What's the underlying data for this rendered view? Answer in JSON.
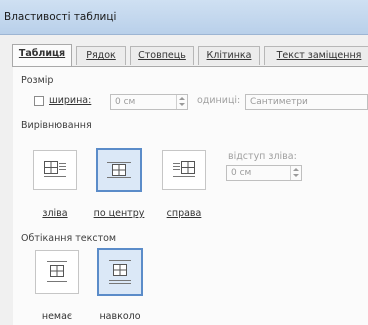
{
  "window": {
    "title": "Властивості таблиці"
  },
  "tabs": [
    {
      "label": "Таблиця",
      "active": true
    },
    {
      "label": "Рядок",
      "active": false
    },
    {
      "label": "Стовпець",
      "active": false
    },
    {
      "label": "Клітинка",
      "active": false
    },
    {
      "label": "Текст заміщення",
      "active": false
    }
  ],
  "size": {
    "section_label": "Розмір",
    "width_label": "ширина:",
    "width_value": "0 см",
    "units_label": "одиниці:",
    "units_value": "Сантиметри"
  },
  "alignment": {
    "section_label": "Вирівнювання",
    "options": [
      {
        "label": "зліва",
        "icon": "align-left-icon",
        "selected": false
      },
      {
        "label": "по центру",
        "icon": "align-center-icon",
        "selected": true
      },
      {
        "label": "справа",
        "icon": "align-right-icon",
        "selected": false
      }
    ],
    "indent_label": "відступ зліва:",
    "indent_value": "0 см"
  },
  "wrapping": {
    "section_label": "Обтікання текстом",
    "options": [
      {
        "label": "немає",
        "icon": "wrap-none-icon",
        "selected": false
      },
      {
        "label": "навколо",
        "icon": "wrap-around-icon",
        "selected": true
      }
    ]
  },
  "colors": {
    "selected_border": "#5b8cc9",
    "selected_fill": "#dbe8f7",
    "titlebar": "#c4d8ef"
  }
}
